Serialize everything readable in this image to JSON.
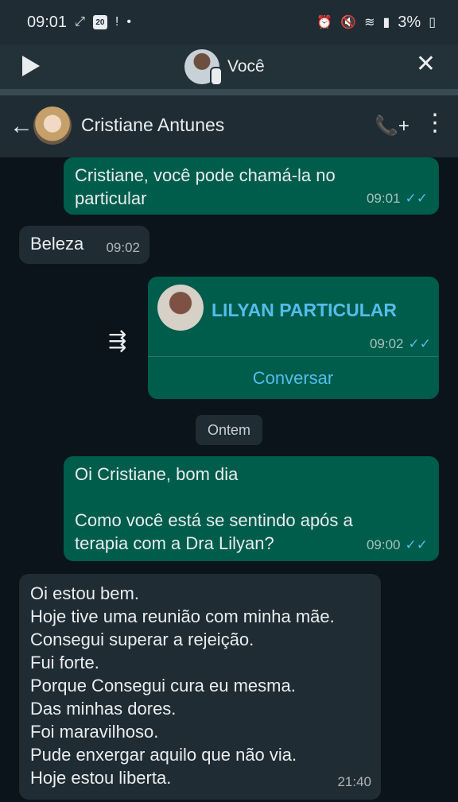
{
  "status": {
    "time": "09:01",
    "calendar_day": "20",
    "battery": "3%"
  },
  "voice_banner": {
    "name": "Você"
  },
  "chat_header": {
    "contact_name": "Cristiane Antunes"
  },
  "messages": {
    "m1": {
      "text": "Cristiane, você pode chamá-la no particular",
      "time": "09:01"
    },
    "m2": {
      "text": "Beleza",
      "time": "09:02"
    },
    "m3": {
      "title": "LILYAN PARTICULAR",
      "time": "09:02",
      "action": "Conversar"
    },
    "day_separator": "Ontem",
    "m4": {
      "text": "Oi Cristiane, bom dia\n\nComo você está se sentindo após a terapia com a Dra Lilyan?",
      "time": "09:00"
    },
    "m5": {
      "text": "Oi estou bem.\nHoje tive uma reunião com minha mãe.\nConsegui superar a rejeição.\nFui forte.\nPorque Consegui cura eu mesma.\nDas minhas dores.\nFoi maravilhoso.\nPude enxergar aquilo que não via.\nHoje estou liberta.",
      "time": "21:40"
    }
  },
  "colors": {
    "background": "#0b141a",
    "outgoing": "#005c4b",
    "incoming": "#202c33",
    "accent": "#53bdeb"
  },
  "icons": {
    "play": "play-icon",
    "close": "close-icon",
    "back": "back-arrow-icon",
    "add_call": "add-call-icon",
    "more": "more-vert-icon",
    "read_receipt": "double-check-icon",
    "forward": "forward-icon"
  }
}
